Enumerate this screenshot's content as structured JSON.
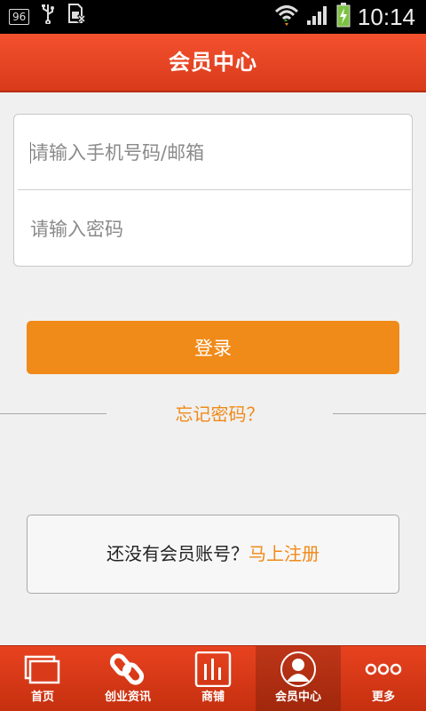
{
  "status_bar": {
    "battery_number": "96",
    "time": "10:14"
  },
  "header": {
    "title": "会员中心"
  },
  "login_form": {
    "phone_placeholder": "请输入手机号码/邮箱",
    "password_placeholder": "请输入密码",
    "login_label": "登录",
    "forgot_label": "忘记密码？"
  },
  "register": {
    "prompt": "还没有会员账号？",
    "link_label": "马上注册"
  },
  "tabs": [
    {
      "label": "首页",
      "icon": "home-icon"
    },
    {
      "label": "创业资讯",
      "icon": "link-icon"
    },
    {
      "label": "商铺",
      "icon": "chart-icon"
    },
    {
      "label": "会员中心",
      "icon": "user-icon",
      "active": true
    },
    {
      "label": "更多",
      "icon": "more-icon"
    }
  ],
  "colors": {
    "brand": "#e8421f",
    "accent": "#f08a18"
  }
}
